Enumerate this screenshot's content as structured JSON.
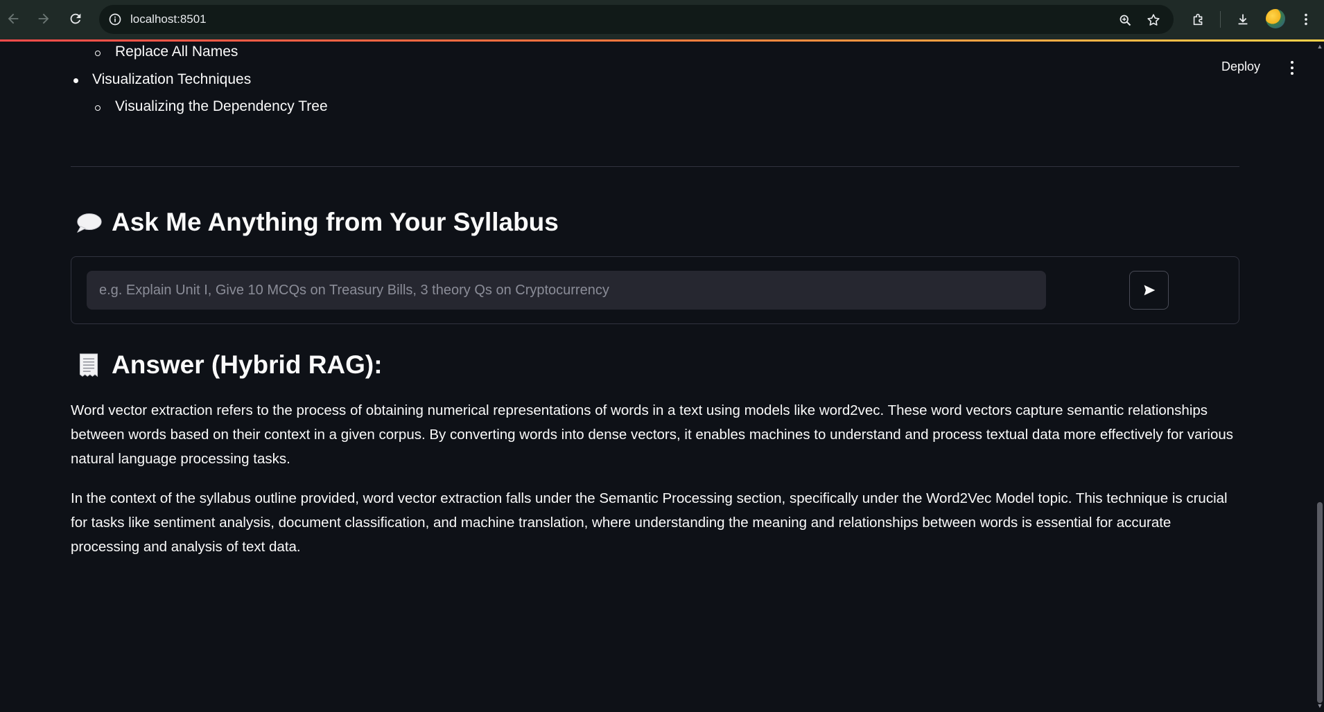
{
  "browser": {
    "url": "localhost:8501"
  },
  "header": {
    "deploy_label": "Deploy"
  },
  "outline_tail": {
    "items": [
      {
        "level": 2,
        "label": "Replace All Names"
      },
      {
        "level": 1,
        "label": "Visualization Techniques"
      },
      {
        "level": 2,
        "label": "Visualizing the Dependency Tree"
      }
    ]
  },
  "ask": {
    "title": "Ask Me Anything from Your Syllabus",
    "placeholder": "e.g. Explain Unit I, Give 10 MCQs on Treasury Bills, 3 theory Qs on Cryptocurrency",
    "value": ""
  },
  "answer": {
    "title": "Answer (Hybrid RAG):",
    "paragraphs": [
      "Word vector extraction refers to the process of obtaining numerical representations of words in a text using models like word2vec. These word vectors capture semantic relationships between words based on their context in a given corpus. By converting words into dense vectors, it enables machines to understand and process textual data more effectively for various natural language processing tasks.",
      "In the context of the syllabus outline provided, word vector extraction falls under the Semantic Processing section, specifically under the Word2Vec Model topic. This technique is crucial for tasks like sentiment analysis, document classification, and machine translation, where understanding the meaning and relationships between words is essential for accurate processing and analysis of text data."
    ]
  },
  "icons": {
    "ask_title_icon": "speech-balloon-icon",
    "answer_title_icon": "receipt-icon",
    "send_icon": "send-arrow-icon"
  },
  "colors": {
    "background": "#0e1117",
    "input_background": "#262730",
    "text": "#fafafa",
    "accent_gradient_start": "#ff4b4b",
    "accent_gradient_end": "#ffd24a"
  }
}
